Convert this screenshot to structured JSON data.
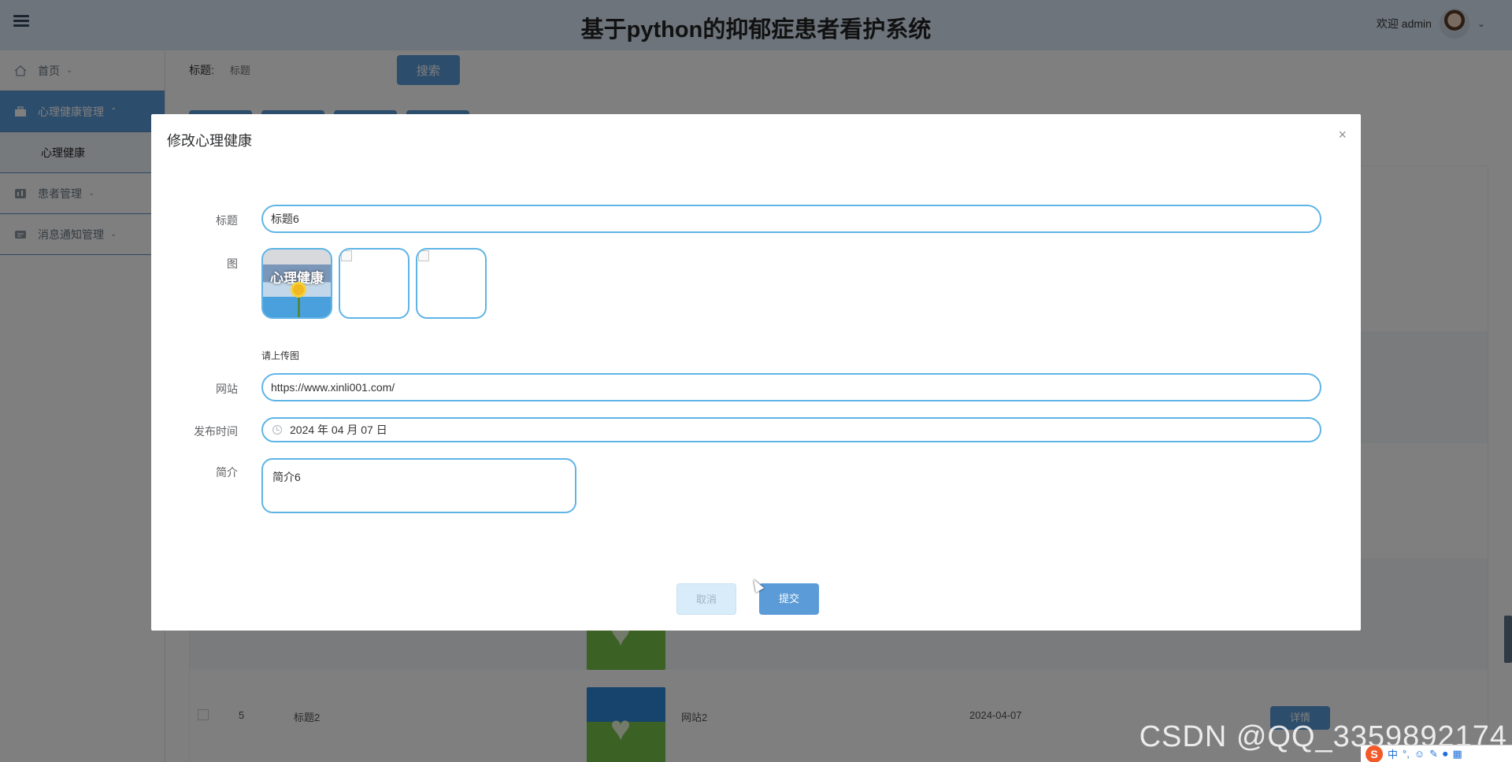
{
  "header": {
    "title": "基于python的抑郁症患者看护系统",
    "welcome": "欢迎 admin"
  },
  "sidebar": {
    "items": [
      {
        "label": "首页",
        "icon": "home-icon"
      },
      {
        "label": "心理健康管理",
        "icon": "briefcase-icon",
        "active": true
      },
      {
        "label": "患者管理",
        "icon": "patient-icon"
      },
      {
        "label": "消息通知管理",
        "icon": "message-icon"
      }
    ],
    "submenu": [
      "心理健康"
    ]
  },
  "main": {
    "search_label": "标题:",
    "search_placeholder": "标题",
    "search_button": "搜索",
    "rows": [
      {
        "index": "5",
        "title": "标题2",
        "site": "网站2",
        "date": "2024-04-07",
        "action": "详情"
      }
    ]
  },
  "dialog": {
    "title": "修改心理健康",
    "fields": {
      "title_label": "标题",
      "title_value": "标题6",
      "image_label": "图",
      "image_caption": "心理健康",
      "upload_hint": "请上传图",
      "site_label": "网站",
      "site_value": "https://www.xinli001.com/",
      "date_label": "发布时间",
      "date_value": "2024 年 04 月 07 日",
      "intro_label": "简介",
      "intro_value": "简介6"
    },
    "buttons": {
      "cancel": "取消",
      "submit": "提交"
    }
  },
  "watermark": "CSDN @QQ_3359892174",
  "tray": {
    "ime_logo": "S",
    "ime_lang": "中"
  },
  "colors": {
    "accent": "#5b9bd8",
    "input_border": "#5fb4e6",
    "header_bg": "#dbe9f8"
  }
}
